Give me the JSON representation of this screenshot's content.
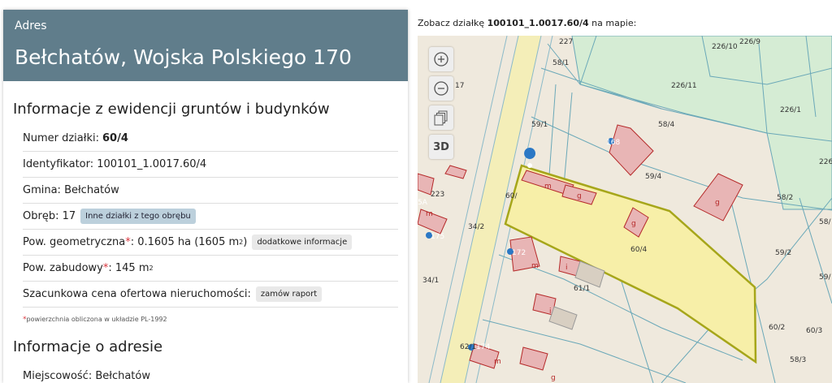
{
  "header": {
    "label": "Adres",
    "address": "Bełchatów, Wojska Polskiego 170"
  },
  "ewidencja": {
    "title": "Informacje z ewidencji gruntów i budynków",
    "numer_label": "Numer działki:",
    "numer_value": "60/4",
    "identyfikator": "Identyfikator: 100101_1.0017.60/4",
    "gmina": "Gmina: Bełchatów",
    "obreb": "Obręb: 17",
    "obreb_button": "Inne działki z tego obrębu",
    "pow_geo_label": "Pow. geometryczna",
    "pow_geo_value": ": 0.1605 ha (1605 m",
    "pow_geo_end": ")",
    "pow_geo_button": "dodatkowe informacje",
    "pow_zab_label": "Pow. zabudowy",
    "pow_zab_value": ": 145 m",
    "cena_label": "Szacunkowa cena ofertowa nieruchomości:",
    "cena_button": "zamów raport",
    "star": "*",
    "sup2": "2",
    "note": "powierzchnia obliczona w układzie PL-1992"
  },
  "adres": {
    "title": "Informacje o adresie",
    "miejscowosc": "Miejscowość: Bełchatów"
  },
  "map": {
    "caption_prefix": "Zobacz działkę",
    "caption_id": "100101_1.0017.60/4",
    "caption_suffix": "na mapie:",
    "btn_3d": "3D",
    "labels": [
      "227",
      "58/1",
      "226/10",
      "226/9",
      "226/11",
      "226/1",
      "226",
      "58/4",
      "59/1",
      "168",
      "59/4",
      "58/2",
      "58/",
      "223",
      "60/",
      "g",
      "m",
      "g",
      "g",
      "5A",
      "175",
      "34/2",
      "60/4",
      "59/2",
      "172",
      "m",
      "i",
      "61/1",
      "34/1",
      "59/",
      "i",
      "60/2",
      "60/3",
      "62/1",
      "174",
      "58/3",
      "m",
      "g",
      "17",
      "m"
    ],
    "colors": {
      "parcel_fill": "#f7efa8",
      "parcel_stroke": "#a6a61a",
      "building": "#e8b5b5",
      "building_stroke": "#b52929",
      "green": "#d5ecd4",
      "marker": "#2b78c5"
    }
  }
}
